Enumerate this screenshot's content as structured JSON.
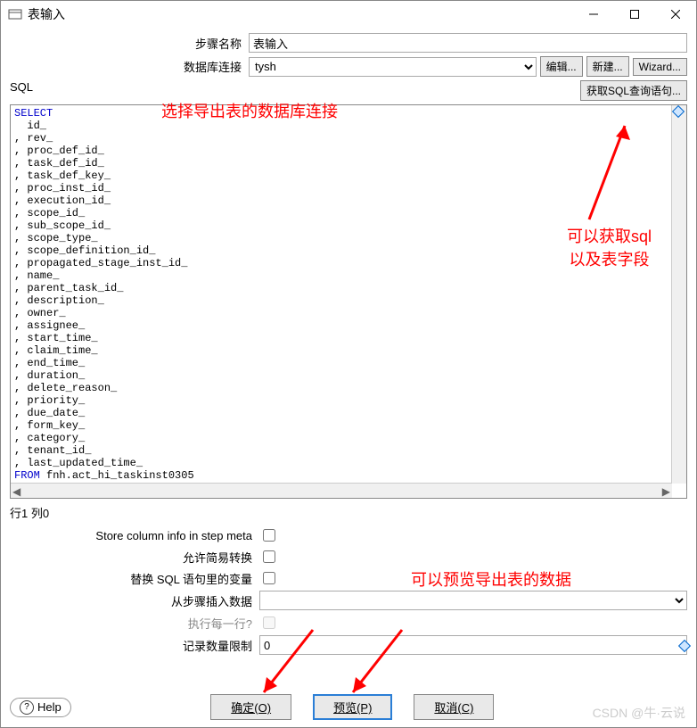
{
  "window": {
    "title": "表输入"
  },
  "form": {
    "step_name_label": "步骤名称",
    "step_name_value": "表输入",
    "db_conn_label": "数据库连接",
    "db_conn_value": "tysh",
    "edit_btn": "编辑...",
    "new_btn": "新建...",
    "wizard_btn": "Wizard..."
  },
  "sql_section": {
    "label": "SQL",
    "get_sql_btn": "获取SQL查询语句...",
    "annotation_conn": "选择导出表的数据库连接",
    "annotation_fields": "可以获取sql以及表字段",
    "sql_select": "SELECT",
    "sql_from": "FROM",
    "sql_table": " fnh.act_hi_taskinst0305",
    "sql_columns": [
      "  id_",
      ", rev_",
      ", proc_def_id_",
      ", task_def_id_",
      ", task_def_key_",
      ", proc_inst_id_",
      ", execution_id_",
      ", scope_id_",
      ", sub_scope_id_",
      ", scope_type_",
      ", scope_definition_id_",
      ", propagated_stage_inst_id_",
      ", name_",
      ", parent_task_id_",
      ", description_",
      ", owner_",
      ", assignee_",
      ", start_time_",
      ", claim_time_",
      ", end_time_",
      ", duration_",
      ", delete_reason_",
      ", priority_",
      ", due_date_",
      ", form_key_",
      ", category_",
      ", tenant_id_",
      ", last_updated_time_"
    ]
  },
  "status": {
    "line": "行1 列0"
  },
  "options": {
    "store_meta_label": "Store column info in step meta",
    "allow_lazy_label": "允许简易转换",
    "replace_var_label": "替换 SQL 语句里的变量",
    "from_step_label": "从步骤插入数据",
    "exec_each_label": "执行每一行?",
    "limit_label": "记录数量限制",
    "limit_value": "0",
    "annotation_preview": "可以预览导出表的数据"
  },
  "buttons": {
    "help": "Help",
    "ok": "确定(O)",
    "preview": "预览(P)",
    "cancel": "取消(C)"
  },
  "watermark": "CSDN @牛·云说"
}
